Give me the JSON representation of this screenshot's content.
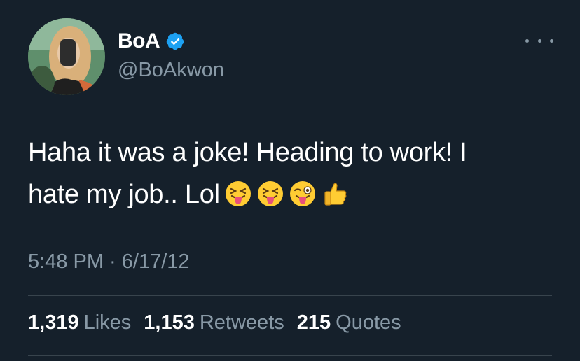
{
  "user": {
    "display_name": "BoA",
    "handle": "@BoAkwon",
    "verified": true
  },
  "tweet": {
    "text_line1": "Haha it was a joke! Heading to work! I",
    "text_line2": "hate my job.. Lol",
    "emojis": [
      "squinting-tongue-emoji",
      "squinting-tongue-emoji",
      "winking-tongue-emoji",
      "thumbs-up-emoji"
    ],
    "timestamp": "5:48 PM · 6/17/12"
  },
  "stats": {
    "likes_count": "1,319",
    "likes_label": "Likes",
    "retweets_count": "1,153",
    "retweets_label": "Retweets",
    "quotes_count": "215",
    "quotes_label": "Quotes"
  },
  "colors": {
    "background": "#15202b",
    "secondary_text": "#8899a6",
    "verified_blue": "#1da1f2",
    "divider": "#38444d"
  }
}
